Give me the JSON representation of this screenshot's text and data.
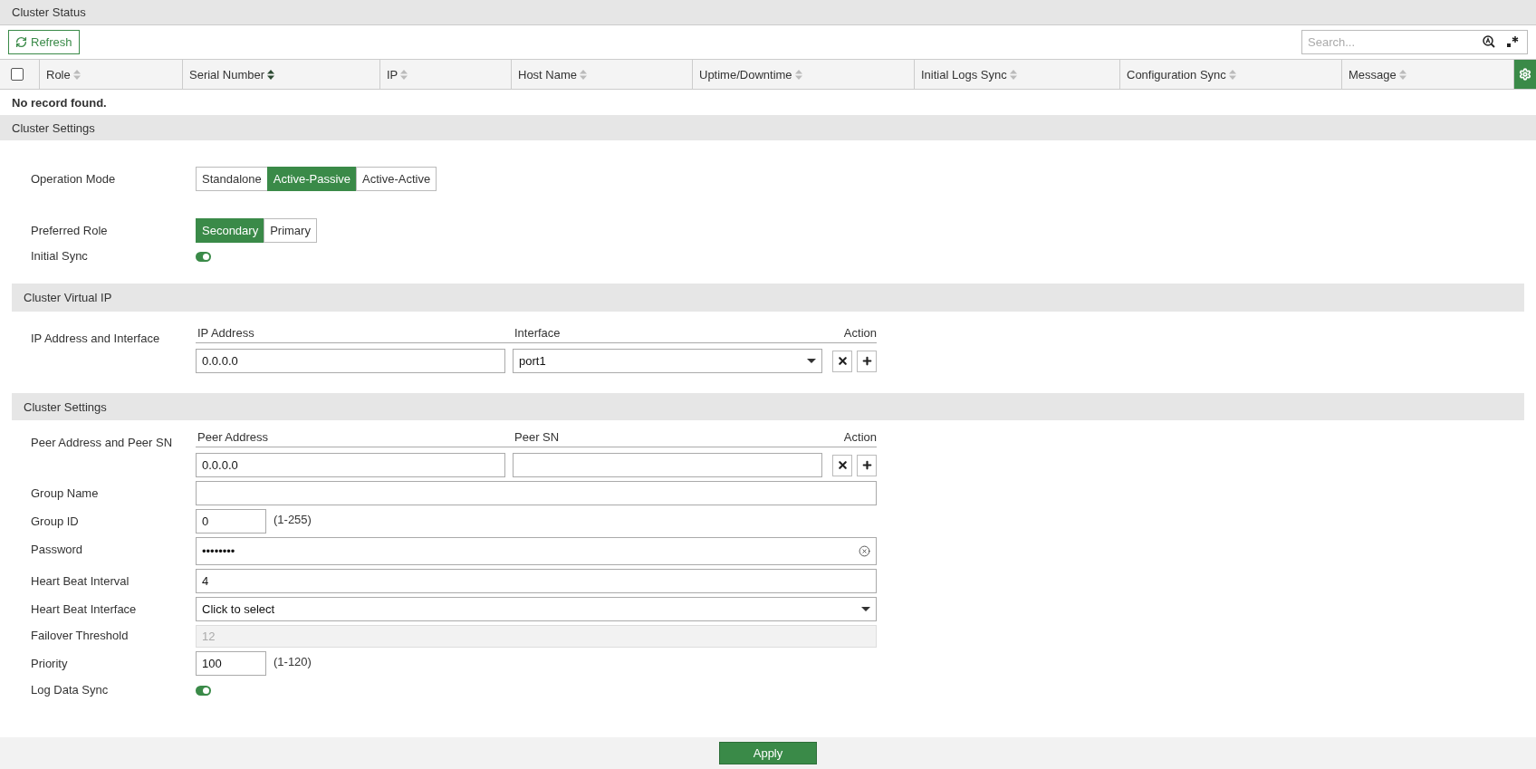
{
  "status_panel": {
    "title": "Cluster Status",
    "refresh_button": "Refresh",
    "search": {
      "placeholder": "Search..."
    },
    "table": {
      "select_all_checked": false,
      "columns": [
        {
          "label": "Role",
          "sorted": false
        },
        {
          "label": "Serial Number",
          "sorted": true
        },
        {
          "label": "IP",
          "sorted": false
        },
        {
          "label": "Host Name",
          "sorted": false
        },
        {
          "label": "Uptime/Downtime",
          "sorted": false
        },
        {
          "label": "Initial Logs Sync",
          "sorted": false
        },
        {
          "label": "Configuration Sync",
          "sorted": false
        },
        {
          "label": "Message",
          "sorted": false
        }
      ],
      "empty_message": "No record found."
    }
  },
  "mode_panel": {
    "title": "Cluster Settings",
    "rows": [
      {
        "kind": "segmented",
        "label": "Operation Mode",
        "options": [
          {
            "label": "Standalone",
            "selected": false
          },
          {
            "label": "Active-Passive",
            "selected": true
          },
          {
            "label": "Active-Active",
            "selected": false
          }
        ]
      },
      {
        "kind": "segmented",
        "label": "Preferred Role",
        "options": [
          {
            "label": "Secondary",
            "selected": true
          },
          {
            "label": "Primary",
            "selected": false
          }
        ]
      },
      {
        "kind": "toggle",
        "label": "Initial Sync",
        "on": true
      }
    ]
  },
  "virtual_ip": {
    "title": "Cluster Virtual IP",
    "label": "IP Address and Interface",
    "columns": [
      "IP Address",
      "Interface",
      "Action"
    ],
    "fields": [
      {
        "kind": "input",
        "value": "0.0.0.0"
      },
      {
        "kind": "select",
        "value": "port1"
      }
    ]
  },
  "cluster_settings": {
    "title": "Cluster Settings",
    "peer": {
      "label": "Peer Address and Peer SN",
      "columns": [
        "Peer Address",
        "Peer SN",
        "Action"
      ],
      "fields": [
        {
          "kind": "input",
          "value": "0.0.0.0"
        },
        {
          "kind": "input"
        }
      ]
    },
    "rows": [
      {
        "kind": "input",
        "label": "Group Name"
      },
      {
        "kind": "short",
        "label": "Group ID",
        "value": "0",
        "hint": "(1-255)"
      },
      {
        "kind": "password",
        "label": "Password",
        "value": "••••••••"
      },
      {
        "kind": "input",
        "label": "Heart Beat Interval",
        "value": "4"
      },
      {
        "kind": "select",
        "label": "Heart Beat Interface",
        "value": "Click to select"
      },
      {
        "kind": "readonly",
        "label": "Failover Threshold",
        "value": "12"
      },
      {
        "kind": "short",
        "label": "Priority",
        "value": "100",
        "hint": "(1-120)"
      },
      {
        "kind": "toggle",
        "label": "Log Data Sync",
        "on": true
      }
    ]
  },
  "footer": {
    "apply_button": "Apply"
  }
}
